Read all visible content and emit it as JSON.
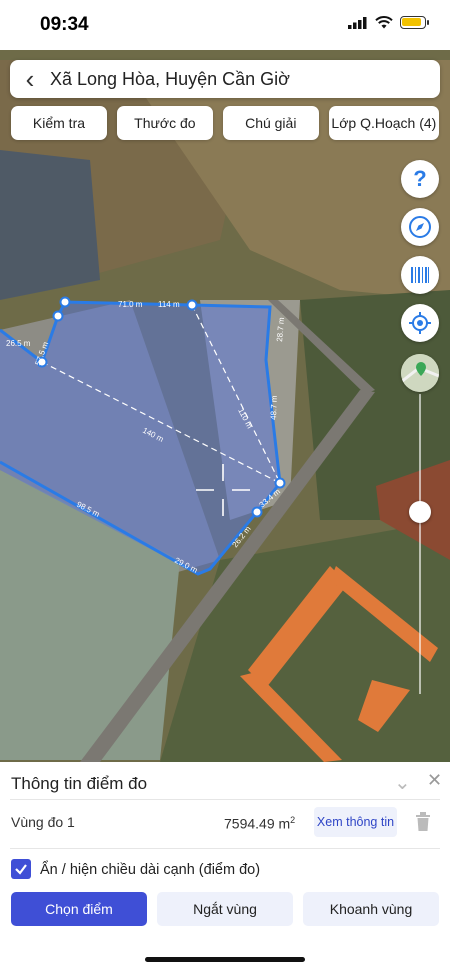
{
  "status": {
    "time": "09:34"
  },
  "header": {
    "title": "Xã Long Hòa, Huyện Cần Giờ"
  },
  "toolbar": {
    "kiem_tra": "Kiểm tra",
    "thuoc_do": "Thước đo",
    "chu_giai": "Chú giải",
    "lop_qh": "Lớp Q.Hoạch (4)"
  },
  "map": {
    "side_buttons": [
      "help-icon",
      "compass-icon",
      "barcode-icon",
      "locate-icon",
      "layer-thumb-icon"
    ],
    "edge_labels": [
      "71.0 m",
      "114 m",
      "28.7 m",
      "48.7 m",
      "110 m",
      "140 m",
      "98.5 m",
      "29.0 m",
      "26.2 m",
      "33.4 m",
      "57.5 m",
      "26.5 m"
    ],
    "colors": {
      "polygon_fill": "#5b78d8",
      "polygon_stroke": "#2a7be6"
    }
  },
  "panel": {
    "title": "Thông tin điểm đo",
    "area_label": "Vùng đo 1",
    "area_value": "7594.49 m",
    "area_unit_sup": "2",
    "info_button": "Xem thông tin",
    "checkbox_label": "Ẩn / hiện chiều dài cạnh (điểm đo)",
    "checkbox_checked": true,
    "btn_chon": "Chọn điểm",
    "btn_ngat": "Ngắt vùng",
    "btn_khoanh": "Khoanh vùng"
  }
}
